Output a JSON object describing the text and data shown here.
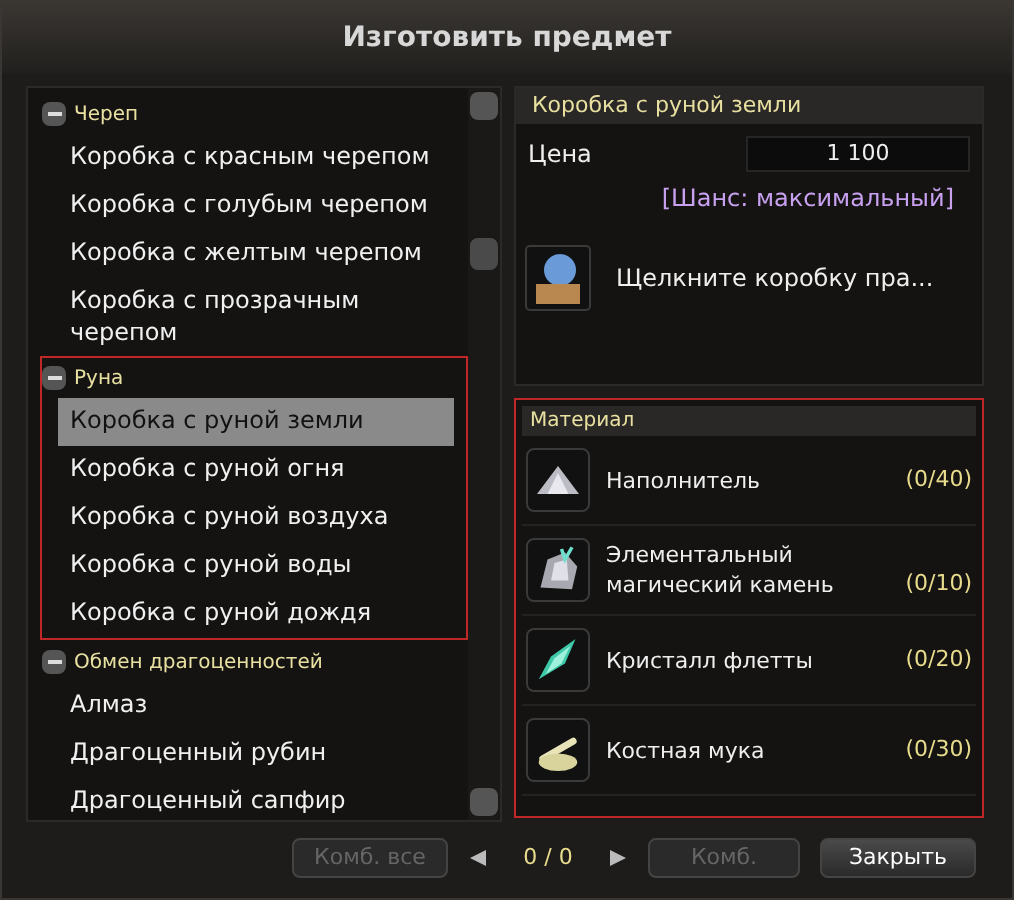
{
  "window": {
    "title": "Изготовить предмет"
  },
  "recipe_list": {
    "groups": [
      {
        "title": "Череп",
        "expanded": true,
        "highlighted": false,
        "items": [
          {
            "label": "Коробка с красным черепом",
            "selected": false
          },
          {
            "label": "Коробка с голубым черепом",
            "selected": false
          },
          {
            "label": "Коробка с желтым черепом",
            "selected": false
          },
          {
            "label": "Коробка с прозрачным черепом",
            "selected": false
          }
        ]
      },
      {
        "title": "Руна",
        "expanded": true,
        "highlighted": true,
        "items": [
          {
            "label": "Коробка с руной земли",
            "selected": true
          },
          {
            "label": "Коробка с руной огня",
            "selected": false
          },
          {
            "label": "Коробка с руной воздуха",
            "selected": false
          },
          {
            "label": "Коробка с руной воды",
            "selected": false
          },
          {
            "label": "Коробка с руной дождя",
            "selected": false
          }
        ]
      },
      {
        "title": "Обмен драгоценностей",
        "expanded": true,
        "highlighted": false,
        "items": [
          {
            "label": "Алмаз",
            "selected": false
          },
          {
            "label": "Драгоценный рубин",
            "selected": false
          },
          {
            "label": "Драгоценный сапфир",
            "selected": false
          }
        ]
      }
    ]
  },
  "detail": {
    "title": "Коробка с руной земли",
    "price_label": "Цена",
    "price": "1 100",
    "chance": "[Шанс: максимальный]",
    "product_hint": "Щелкните коробку пра..."
  },
  "materials": {
    "title": "Материал",
    "highlighted": true,
    "items": [
      {
        "name": "Наполнитель",
        "count": "(0/40)",
        "kind": "powder"
      },
      {
        "name": "Элементальный магический камень",
        "count": "(0/10)",
        "kind": "stone"
      },
      {
        "name": "Кристалл флетты",
        "count": "(0/20)",
        "kind": "crystal"
      },
      {
        "name": "Костная мука",
        "count": "(0/30)",
        "kind": "bone"
      }
    ]
  },
  "footer": {
    "combine_all": {
      "label": "Комб. все",
      "disabled": true
    },
    "page": "0 / 0",
    "combine": {
      "label": "Комб.",
      "disabled": true
    },
    "close": {
      "label": "Закрыть",
      "disabled": false
    }
  }
}
